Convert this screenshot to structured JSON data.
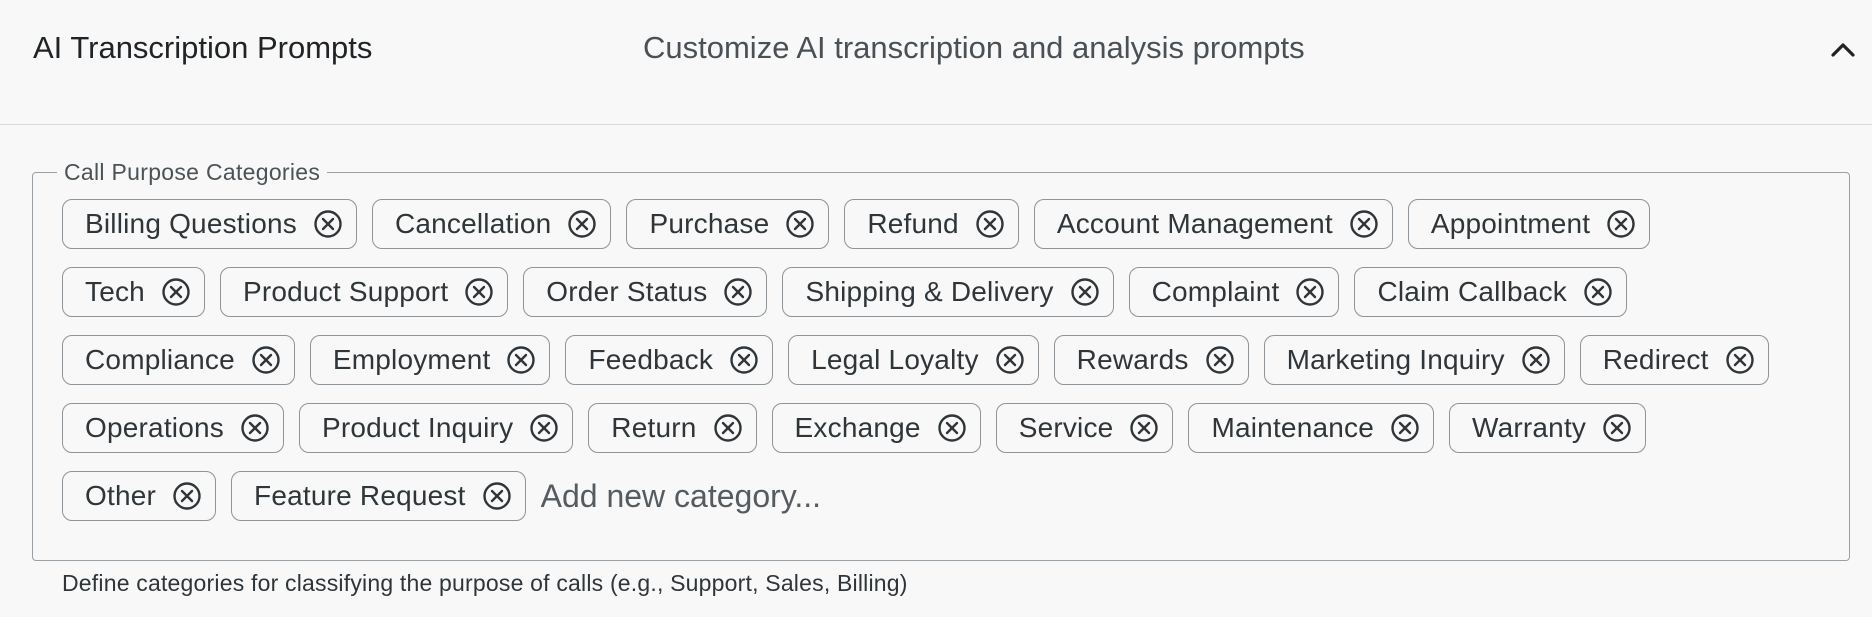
{
  "header": {
    "title": "AI Transcription Prompts",
    "subtitle": "Customize AI transcription and analysis prompts",
    "toggle_icon": "chevron-up-icon"
  },
  "categories": {
    "legend": "Call Purpose Categories",
    "remove_icon": "cancel-circle-icon",
    "rows": [
      [
        {
          "label": "Billing Questions"
        },
        {
          "label": "Cancellation"
        },
        {
          "label": "Purchase"
        },
        {
          "label": "Refund"
        },
        {
          "label": "Account Management"
        },
        {
          "label": "Appointment"
        }
      ],
      [
        {
          "label": "Tech"
        },
        {
          "label": "Product Support"
        },
        {
          "label": "Order Status"
        },
        {
          "label": "Shipping & Delivery"
        },
        {
          "label": "Complaint"
        },
        {
          "label": "Claim Callback"
        }
      ],
      [
        {
          "label": "Compliance"
        },
        {
          "label": "Employment"
        },
        {
          "label": "Feedback"
        },
        {
          "label": "Legal Loyalty"
        },
        {
          "label": "Rewards"
        },
        {
          "label": "Marketing Inquiry"
        },
        {
          "label": "Redirect"
        }
      ],
      [
        {
          "label": "Operations"
        },
        {
          "label": "Product Inquiry"
        },
        {
          "label": "Return"
        },
        {
          "label": "Exchange"
        },
        {
          "label": "Service"
        },
        {
          "label": "Maintenance"
        },
        {
          "label": "Warranty"
        }
      ],
      [
        {
          "label": "Other"
        },
        {
          "label": "Feature Request"
        }
      ]
    ],
    "add_placeholder": "Add new category...",
    "add_value": "",
    "helper_text": "Define categories for classifying the purpose of calls (e.g., Support, Sales, Billing)"
  },
  "colors": {
    "background": "#f7f8f7",
    "chip_border": "#8f9498",
    "text": "#2f3539"
  }
}
